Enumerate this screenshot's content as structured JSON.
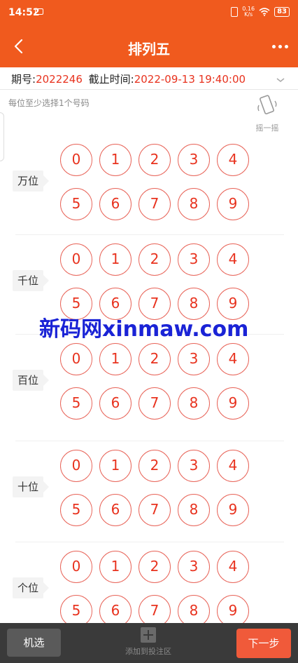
{
  "status_bar": {
    "time": "14:52",
    "net_speed_top": "0.16",
    "net_speed_bottom": "K/s",
    "battery": "83"
  },
  "nav": {
    "title": "排列五"
  },
  "issue": {
    "period_label": "期号:",
    "period_value": "2022246",
    "deadline_label": "截止时间:",
    "deadline_value": "2022-09-13 19:40:00"
  },
  "hint": "每位至少选择1个号码",
  "shake_label": "摇一摇",
  "positions": [
    {
      "label": "万位",
      "numbers": [
        "0",
        "1",
        "2",
        "3",
        "4",
        "5",
        "6",
        "7",
        "8",
        "9"
      ]
    },
    {
      "label": "千位",
      "numbers": [
        "0",
        "1",
        "2",
        "3",
        "4",
        "5",
        "6",
        "7",
        "8",
        "9"
      ]
    },
    {
      "label": "百位",
      "numbers": [
        "0",
        "1",
        "2",
        "3",
        "4",
        "5",
        "6",
        "7",
        "8",
        "9"
      ]
    },
    {
      "label": "十位",
      "numbers": [
        "0",
        "1",
        "2",
        "3",
        "4",
        "5",
        "6",
        "7",
        "8",
        "9"
      ]
    },
    {
      "label": "个位",
      "numbers": [
        "0",
        "1",
        "2",
        "3",
        "4",
        "5",
        "6",
        "7",
        "8",
        "9"
      ]
    }
  ],
  "watermark": "新码网xinmaw.com",
  "bottom": {
    "random_label": "机选",
    "add_label": "添加到投注区",
    "next_label": "下一步"
  },
  "colors": {
    "brand": "#f05a1e",
    "ball_text": "#e8321e",
    "ball_border": "#e8655a",
    "bottom_bar": "#3a3a3a",
    "watermark": "#1a23d6"
  }
}
